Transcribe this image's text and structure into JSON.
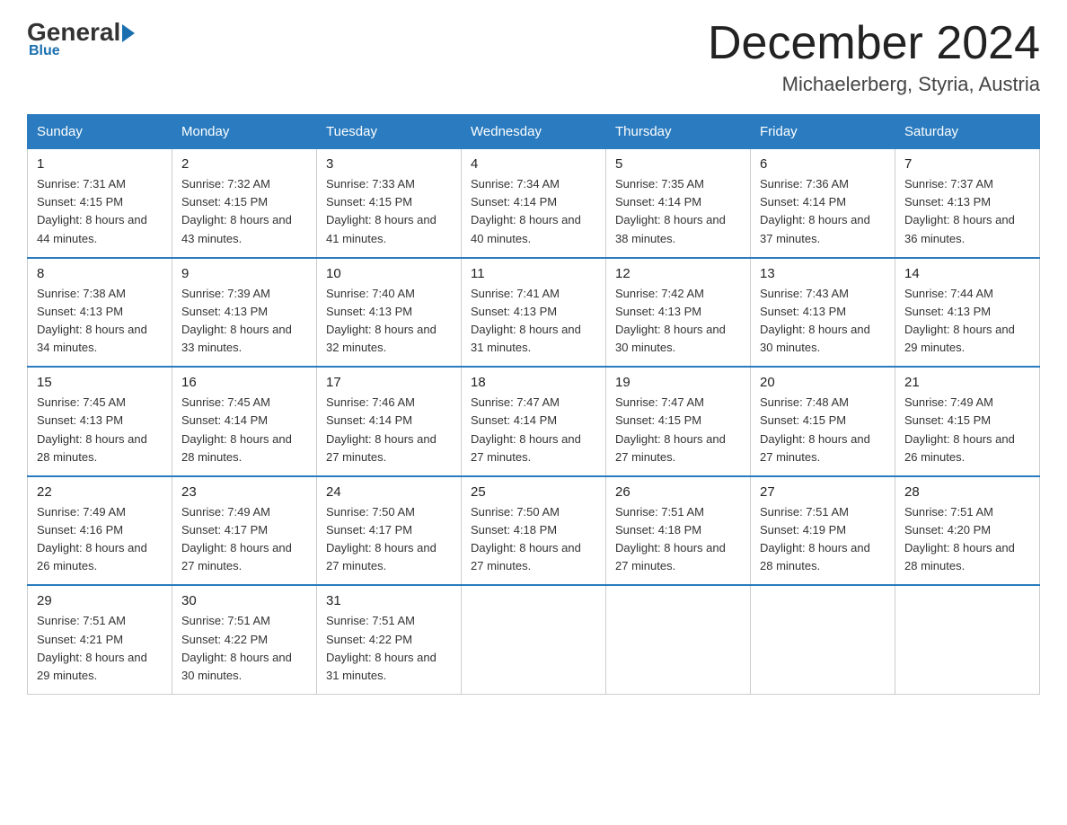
{
  "header": {
    "logo": {
      "general": "General",
      "blue": "Blue",
      "underline": "Blue"
    },
    "title": "December 2024",
    "location": "Michaelerberg, Styria, Austria"
  },
  "days_of_week": [
    "Sunday",
    "Monday",
    "Tuesday",
    "Wednesday",
    "Thursday",
    "Friday",
    "Saturday"
  ],
  "weeks": [
    [
      {
        "day": "1",
        "sunrise": "7:31 AM",
        "sunset": "4:15 PM",
        "daylight": "8 hours and 44 minutes."
      },
      {
        "day": "2",
        "sunrise": "7:32 AM",
        "sunset": "4:15 PM",
        "daylight": "8 hours and 43 minutes."
      },
      {
        "day": "3",
        "sunrise": "7:33 AM",
        "sunset": "4:15 PM",
        "daylight": "8 hours and 41 minutes."
      },
      {
        "day": "4",
        "sunrise": "7:34 AM",
        "sunset": "4:14 PM",
        "daylight": "8 hours and 40 minutes."
      },
      {
        "day": "5",
        "sunrise": "7:35 AM",
        "sunset": "4:14 PM",
        "daylight": "8 hours and 38 minutes."
      },
      {
        "day": "6",
        "sunrise": "7:36 AM",
        "sunset": "4:14 PM",
        "daylight": "8 hours and 37 minutes."
      },
      {
        "day": "7",
        "sunrise": "7:37 AM",
        "sunset": "4:13 PM",
        "daylight": "8 hours and 36 minutes."
      }
    ],
    [
      {
        "day": "8",
        "sunrise": "7:38 AM",
        "sunset": "4:13 PM",
        "daylight": "8 hours and 34 minutes."
      },
      {
        "day": "9",
        "sunrise": "7:39 AM",
        "sunset": "4:13 PM",
        "daylight": "8 hours and 33 minutes."
      },
      {
        "day": "10",
        "sunrise": "7:40 AM",
        "sunset": "4:13 PM",
        "daylight": "8 hours and 32 minutes."
      },
      {
        "day": "11",
        "sunrise": "7:41 AM",
        "sunset": "4:13 PM",
        "daylight": "8 hours and 31 minutes."
      },
      {
        "day": "12",
        "sunrise": "7:42 AM",
        "sunset": "4:13 PM",
        "daylight": "8 hours and 30 minutes."
      },
      {
        "day": "13",
        "sunrise": "7:43 AM",
        "sunset": "4:13 PM",
        "daylight": "8 hours and 30 minutes."
      },
      {
        "day": "14",
        "sunrise": "7:44 AM",
        "sunset": "4:13 PM",
        "daylight": "8 hours and 29 minutes."
      }
    ],
    [
      {
        "day": "15",
        "sunrise": "7:45 AM",
        "sunset": "4:13 PM",
        "daylight": "8 hours and 28 minutes."
      },
      {
        "day": "16",
        "sunrise": "7:45 AM",
        "sunset": "4:14 PM",
        "daylight": "8 hours and 28 minutes."
      },
      {
        "day": "17",
        "sunrise": "7:46 AM",
        "sunset": "4:14 PM",
        "daylight": "8 hours and 27 minutes."
      },
      {
        "day": "18",
        "sunrise": "7:47 AM",
        "sunset": "4:14 PM",
        "daylight": "8 hours and 27 minutes."
      },
      {
        "day": "19",
        "sunrise": "7:47 AM",
        "sunset": "4:15 PM",
        "daylight": "8 hours and 27 minutes."
      },
      {
        "day": "20",
        "sunrise": "7:48 AM",
        "sunset": "4:15 PM",
        "daylight": "8 hours and 27 minutes."
      },
      {
        "day": "21",
        "sunrise": "7:49 AM",
        "sunset": "4:15 PM",
        "daylight": "8 hours and 26 minutes."
      }
    ],
    [
      {
        "day": "22",
        "sunrise": "7:49 AM",
        "sunset": "4:16 PM",
        "daylight": "8 hours and 26 minutes."
      },
      {
        "day": "23",
        "sunrise": "7:49 AM",
        "sunset": "4:17 PM",
        "daylight": "8 hours and 27 minutes."
      },
      {
        "day": "24",
        "sunrise": "7:50 AM",
        "sunset": "4:17 PM",
        "daylight": "8 hours and 27 minutes."
      },
      {
        "day": "25",
        "sunrise": "7:50 AM",
        "sunset": "4:18 PM",
        "daylight": "8 hours and 27 minutes."
      },
      {
        "day": "26",
        "sunrise": "7:51 AM",
        "sunset": "4:18 PM",
        "daylight": "8 hours and 27 minutes."
      },
      {
        "day": "27",
        "sunrise": "7:51 AM",
        "sunset": "4:19 PM",
        "daylight": "8 hours and 28 minutes."
      },
      {
        "day": "28",
        "sunrise": "7:51 AM",
        "sunset": "4:20 PM",
        "daylight": "8 hours and 28 minutes."
      }
    ],
    [
      {
        "day": "29",
        "sunrise": "7:51 AM",
        "sunset": "4:21 PM",
        "daylight": "8 hours and 29 minutes."
      },
      {
        "day": "30",
        "sunrise": "7:51 AM",
        "sunset": "4:22 PM",
        "daylight": "8 hours and 30 minutes."
      },
      {
        "day": "31",
        "sunrise": "7:51 AM",
        "sunset": "4:22 PM",
        "daylight": "8 hours and 31 minutes."
      },
      null,
      null,
      null,
      null
    ]
  ]
}
